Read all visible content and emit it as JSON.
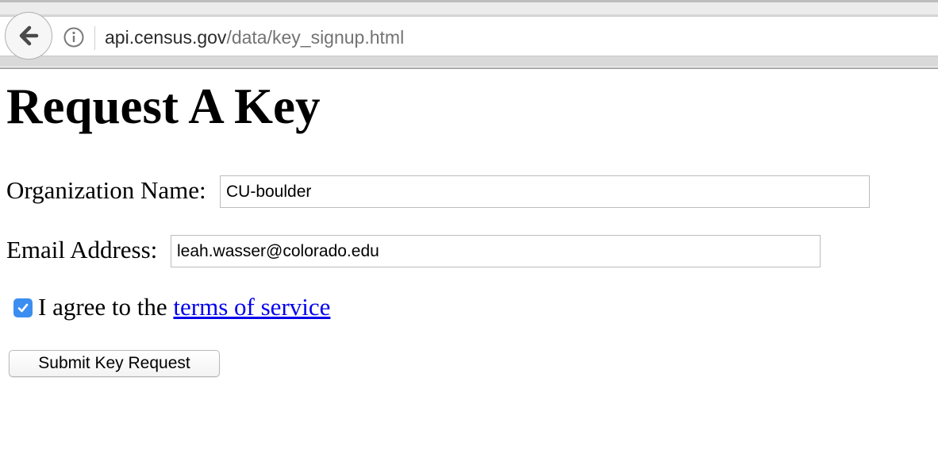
{
  "browser": {
    "url_host": "api.census.gov",
    "url_path": "/data/key_signup.html",
    "back_icon": "arrow-left-icon",
    "info_icon": "info-circle-icon"
  },
  "page": {
    "title": "Request A Key",
    "org_label": "Organization Name:",
    "org_value": "CU-boulder",
    "email_label": "Email Address:",
    "email_value": "leah.wasser@colorado.edu",
    "agree_checked": true,
    "agree_prefix": "I agree to the ",
    "tos_link": "terms of service",
    "submit_label": "Submit Key Request"
  },
  "colors": {
    "link": "#0000ee",
    "checkbox_accent": "#3b8ef0"
  }
}
